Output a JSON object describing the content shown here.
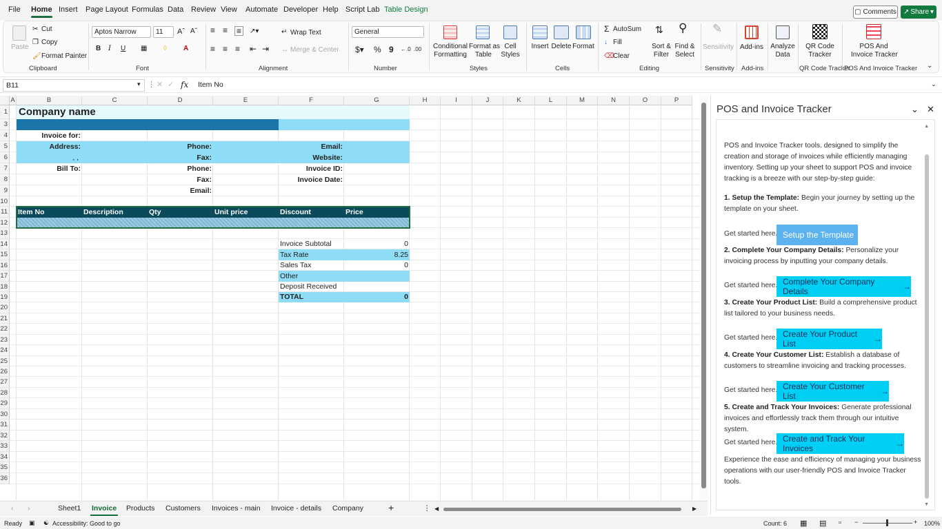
{
  "menu": {
    "items": [
      "File",
      "Home",
      "Insert",
      "Page Layout",
      "Formulas",
      "Data",
      "Review",
      "View",
      "Automate",
      "Developer",
      "Help",
      "Script Lab",
      "Table Design"
    ],
    "comments_label": "Comments",
    "share_label": "Share"
  },
  "ribbon": {
    "clipboard": {
      "paste": "Paste",
      "cut": "Cut",
      "copy": "Copy",
      "format_painter": "Format Painter",
      "label": "Clipboard"
    },
    "font": {
      "family": "Aptos Narrow",
      "size": "11",
      "label": "Font"
    },
    "alignment": {
      "wrap_text": "Wrap Text",
      "merge_center": "Merge & Center",
      "label": "Alignment"
    },
    "number": {
      "format": "General",
      "label": "Number"
    },
    "styles": {
      "conditional": [
        "Conditional",
        "Formatting"
      ],
      "format_table": [
        "Format as",
        "Table"
      ],
      "cell_styles": [
        "Cell",
        "Styles"
      ],
      "label": "Styles"
    },
    "cells": {
      "insert": "Insert",
      "delete": "Delete",
      "format": "Format",
      "label": "Cells"
    },
    "editing": {
      "autosum": "AutoSum",
      "fill": "Fill",
      "clear": "Clear",
      "sort": [
        "Sort &",
        "Filter"
      ],
      "find": [
        "Find &",
        "Select"
      ],
      "label": "Editing"
    },
    "sensitivity": {
      "btn": "Sensitivity",
      "label": "Sensitivity"
    },
    "addins": {
      "btn": "Add-ins",
      "label": "Add-ins"
    },
    "analyze": {
      "btn": [
        "Analyze",
        "Data"
      ]
    },
    "qr": {
      "btn": [
        "QR Code",
        "Tracker"
      ],
      "label": "QR Code Tracker"
    },
    "pos": {
      "btn": [
        "POS And",
        "Invoice Tracker"
      ],
      "label": "POS And Invoice Tracker"
    }
  },
  "formula": {
    "namebox": "B11",
    "fx": "fx",
    "value": "Item No"
  },
  "columns": [
    "A",
    "B",
    "C",
    "D",
    "E",
    "F",
    "G",
    "H",
    "I",
    "J",
    "K",
    "L",
    "M",
    "N",
    "O",
    "P"
  ],
  "rows": [
    "1",
    "3",
    "4",
    "5",
    "6",
    "7",
    "8",
    "9",
    "10",
    "11",
    "12",
    "13",
    "14",
    "15",
    "16",
    "17",
    "18",
    "19",
    "20",
    "21",
    "22",
    "23",
    "24",
    "25",
    "26",
    "27",
    "28",
    "29",
    "30",
    "31",
    "32",
    "33",
    "34",
    "35",
    "36"
  ],
  "invoice": {
    "company_name": "Company name",
    "invoice_for": "Invoice for:",
    "address": "Address:",
    "address_val": ", ,",
    "bill_to": "Bill To:",
    "phone1": "Phone:",
    "fax1": "Fax:",
    "phone2": "Phone:",
    "fax2": "Fax:",
    "email2": "Email:",
    "email": "Email:",
    "website": "Website:",
    "invoice_id": "Invoice ID:",
    "invoice_date": "Invoice Date:",
    "table_headers": [
      "Item No",
      "Description",
      "Qty",
      "Unit price",
      "Discount",
      "Price"
    ],
    "summary": [
      {
        "label": "Invoice Subtotal",
        "value": "0"
      },
      {
        "label": "Tax Rate",
        "value": "8.25"
      },
      {
        "label": "Sales Tax",
        "value": "0"
      },
      {
        "label": "Other",
        "value": ""
      },
      {
        "label": "Deposit Received",
        "value": ""
      },
      {
        "label": "TOTAL",
        "value": "0"
      }
    ]
  },
  "sheets": [
    "Sheet1",
    "Invoice",
    "Products",
    "Customers",
    "Invoices - main",
    "Invoice - details",
    "Company"
  ],
  "status": {
    "ready": "Ready",
    "accessibility": "Accessibility: Good to go",
    "count": "Count: 6",
    "zoom": "100%"
  },
  "pane": {
    "title": "POS and Invoice Tracker",
    "intro": "POS and Invoice Tracker tools. designed to simplify the creation and storage of invoices while efficiently managing inventory. Setting up your sheet to support POS and invoice tracking is a breeze with our step-by-step guide:",
    "get_started": "Get started here.",
    "steps": [
      {
        "title": "1. Setup the Template:",
        "desc": "Begin your journey by setting up the template on your sheet.",
        "button": "Setup the Template"
      },
      {
        "title": "2. Complete Your Company Details:",
        "desc": "Personalize your invoicing process by inputting your company details.",
        "button": "Complete Your Company Details"
      },
      {
        "title": "3. Create Your Product List:",
        "desc": "Build a comprehensive product list tailored to your business needs.",
        "button": "Create Your Product List"
      },
      {
        "title": "4. Create Your Customer List:",
        "desc": "Establish a database of customers to streamline invoicing and tracking processes.",
        "button": "Create Your Customer List"
      },
      {
        "title": "5. Create and Track Your Invoices:",
        "desc": "Generate professional invoices and effortlessly track them through our intuitive system.",
        "button": "Create and Track Your Invoices"
      }
    ],
    "outro": "Experience the ease and efficiency of managing your business operations with our user-friendly POS and Invoice Tracker tools."
  },
  "colors": {
    "accent_green": "#127a3f",
    "header_teal": "#0a4a5a",
    "band_dark": "#1b75a8",
    "band_mid": "#8fdcf6",
    "band_light": "#e6f9fd",
    "pane_button": "#00cff5"
  }
}
